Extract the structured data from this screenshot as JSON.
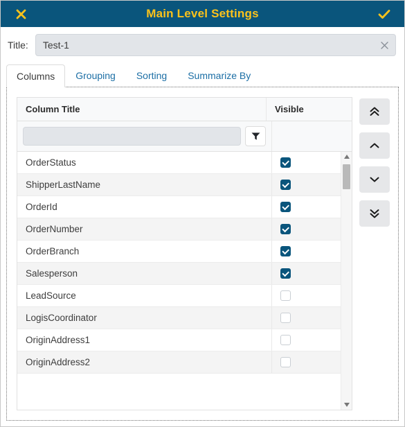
{
  "window": {
    "title": "Main Level Settings",
    "close_icon": "close-x-icon",
    "confirm_icon": "check-icon",
    "header_bg": "#0a557c",
    "header_fg": "#fcc21b"
  },
  "title_field": {
    "label": "Title:",
    "value": "Test-1",
    "placeholder": "",
    "clear_icon": "close-x-icon"
  },
  "tabs": [
    {
      "label": "Columns",
      "active": true
    },
    {
      "label": "Grouping",
      "active": false
    },
    {
      "label": "Sorting",
      "active": false
    },
    {
      "label": "Summarize By",
      "active": false
    }
  ],
  "grid": {
    "headers": {
      "column_title": "Column Title",
      "visible": "Visible"
    },
    "filter": {
      "value": "",
      "placeholder": "",
      "button_icon": "funnel-filter-icon"
    },
    "rows": [
      {
        "name": "OrderStatus",
        "visible": true
      },
      {
        "name": "ShipperLastName",
        "visible": true
      },
      {
        "name": "OrderId",
        "visible": true
      },
      {
        "name": "OrderNumber",
        "visible": true
      },
      {
        "name": "OrderBranch",
        "visible": true
      },
      {
        "name": "Salesperson",
        "visible": true
      },
      {
        "name": "LeadSource",
        "visible": false
      },
      {
        "name": "LogisCoordinator",
        "visible": false
      },
      {
        "name": "OriginAddress1",
        "visible": false
      },
      {
        "name": "OriginAddress2",
        "visible": false
      }
    ],
    "scrollbar": {
      "up_arrow_icon": "triangle-up-icon",
      "down_arrow_icon": "triangle-down-icon"
    },
    "checked_color": "#0a557c"
  },
  "move_buttons": [
    {
      "name": "move-to-top-button",
      "icon": "double-chevron-up-icon"
    },
    {
      "name": "move-up-button",
      "icon": "chevron-up-icon"
    },
    {
      "name": "move-down-button",
      "icon": "chevron-down-icon"
    },
    {
      "name": "move-to-bottom-button",
      "icon": "double-chevron-down-icon"
    }
  ]
}
